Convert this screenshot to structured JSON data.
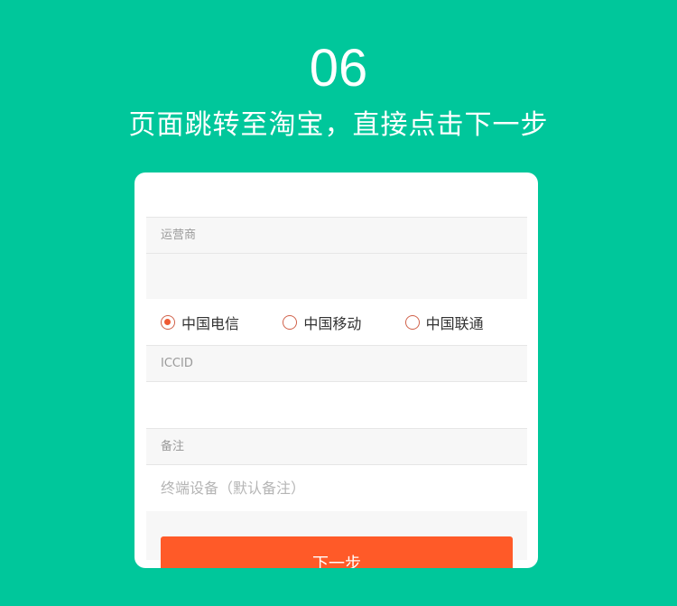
{
  "header": {
    "step_number": "06",
    "caption": "页面跳转至淘宝，直接点击下一步"
  },
  "form": {
    "carrier_label": "运营商",
    "carrier_options": [
      {
        "label": "中国电信",
        "selected": true
      },
      {
        "label": "中国移动",
        "selected": false
      },
      {
        "label": "中国联通",
        "selected": false
      }
    ],
    "iccid_label": "ICCID",
    "iccid_value": "",
    "note_label": "备注",
    "note_placeholder": "终端设备（默认备注）",
    "next_label": "下一步"
  },
  "colors": {
    "background": "#00c79b",
    "accent": "#ff5a28",
    "radio_border": "#d0614a"
  }
}
